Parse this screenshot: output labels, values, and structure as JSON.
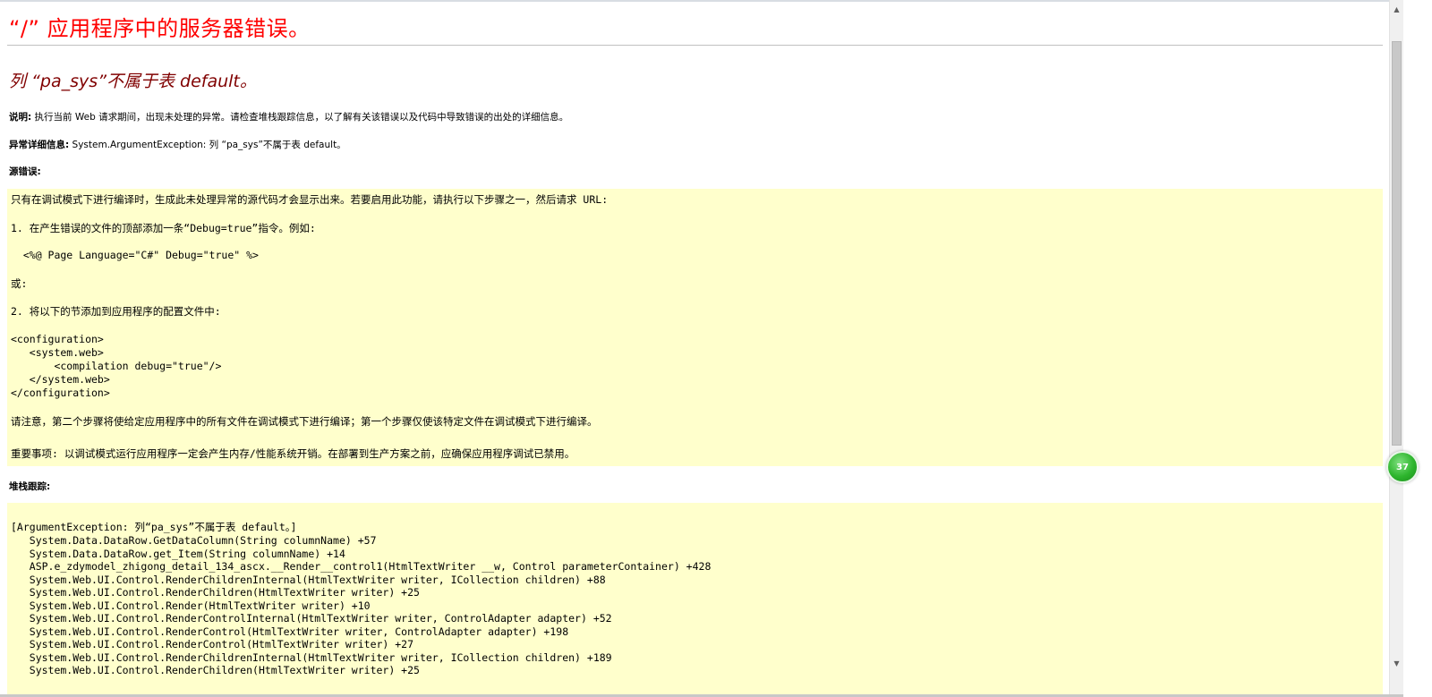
{
  "page": {
    "title": "“/” 应用程序中的服务器错误。",
    "error_message": "列 “pa_sys”不属于表 default。"
  },
  "description": {
    "label": "说明:",
    "text": " 执行当前 Web 请求期间，出现未处理的异常。请检查堆栈跟踪信息，以了解有关该错误以及代码中导致错误的出处的详细信息。"
  },
  "exception_details": {
    "label": "异常详细信息:",
    "text": " System.ArgumentException: 列 “pa_sys”不属于表 default。"
  },
  "source_error": {
    "label": "源错误:",
    "lines": [
      "只有在调试模式下进行编译时，生成此未处理异常的源代码才会显示出来。若要启用此功能，请执行以下步骤之一，然后请求 URL:",
      "1. 在产生错误的文件的顶部添加一条“Debug=true”指令。例如:",
      "  <%@ Page Language=\"C#\" Debug=\"true\" %>",
      "或:",
      "2. 将以下的节添加到应用程序的配置文件中:",
      "<configuration>",
      "   <system.web>",
      "       <compilation debug=\"true\"/>",
      "   </system.web>",
      "</configuration>",
      "请注意，第二个步骤将使给定应用程序中的所有文件在调试模式下进行编译；第一个步骤仅使该特定文件在调试模式下进行编译。",
      "重要事项: 以调试模式运行应用程序一定会产生内存/性能系统开销。在部署到生产方案之前，应确保应用程序调试已禁用。"
    ]
  },
  "stack_trace": {
    "label": "堆栈跟踪:",
    "lines": [
      "[ArgumentException: 列“pa_sys”不属于表 default。]",
      "   System.Data.DataRow.GetDataColumn(String columnName) +57",
      "   System.Data.DataRow.get_Item(String columnName) +14",
      "   ASP.e_zdymodel_zhigong_detail_134_ascx.__Render__control1(HtmlTextWriter __w, Control parameterContainer) +428",
      "   System.Web.UI.Control.RenderChildrenInternal(HtmlTextWriter writer, ICollection children) +88",
      "   System.Web.UI.Control.RenderChildren(HtmlTextWriter writer) +25",
      "   System.Web.UI.Control.Render(HtmlTextWriter writer) +10",
      "   System.Web.UI.Control.RenderControlInternal(HtmlTextWriter writer, ControlAdapter adapter) +52",
      "   System.Web.UI.Control.RenderControl(HtmlTextWriter writer, ControlAdapter adapter) +198",
      "   System.Web.UI.Control.RenderControl(HtmlTextWriter writer) +27",
      "   System.Web.UI.Control.RenderChildrenInternal(HtmlTextWriter writer, ICollection children) +189",
      "   System.Web.UI.Control.RenderChildren(HtmlTextWriter writer) +25"
    ]
  },
  "overlay": {
    "badge_text": "37"
  },
  "colors": {
    "title": "#ff0000",
    "error_message": "#800000",
    "code_background": "#ffffcc"
  },
  "icons": {
    "scroll_up": "triangle-up-icon",
    "scroll_down": "triangle-down-icon"
  }
}
